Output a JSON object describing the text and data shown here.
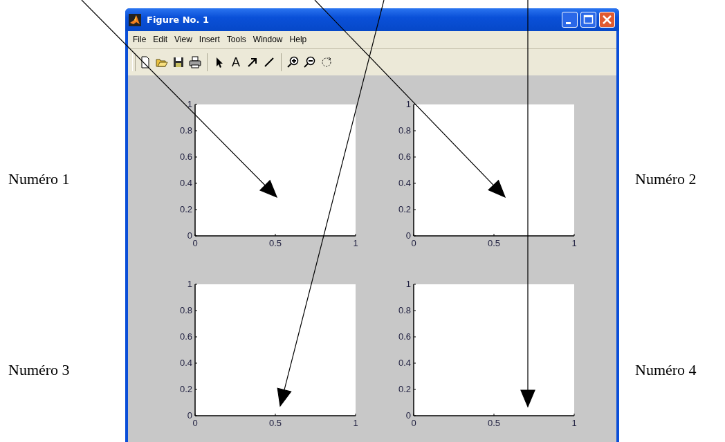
{
  "labels": [
    "Numéro 1",
    "Numéro 2",
    "Numéro 3",
    "Numéro 4"
  ],
  "window": {
    "title": "Figure No. 1"
  },
  "menu": [
    "File",
    "Edit",
    "View",
    "Insert",
    "Tools",
    "Window",
    "Help"
  ],
  "toolbar": [
    {
      "kind": "new"
    },
    {
      "kind": "open"
    },
    {
      "kind": "save"
    },
    {
      "kind": "print"
    },
    {
      "kind": "separator"
    },
    {
      "kind": "select"
    },
    {
      "kind": "text",
      "label": "A"
    },
    {
      "kind": "arrow"
    },
    {
      "kind": "line"
    },
    {
      "kind": "separator"
    },
    {
      "kind": "zoom-in"
    },
    {
      "kind": "zoom-out"
    },
    {
      "kind": "rotate"
    }
  ],
  "subplots": [
    {
      "chart_data": {
        "type": "line",
        "xlim": [
          0,
          1
        ],
        "ylim": [
          0,
          1
        ],
        "xticks": [
          0,
          0.5,
          1
        ],
        "yticks": [
          0,
          0.2,
          0.4,
          0.6,
          0.8,
          1
        ]
      }
    },
    {
      "chart_data": {
        "type": "line",
        "xlim": [
          0,
          1
        ],
        "ylim": [
          0,
          1
        ],
        "xticks": [
          0,
          0.5,
          1
        ],
        "yticks": [
          0,
          0.2,
          0.4,
          0.6,
          0.8,
          1
        ]
      }
    },
    {
      "chart_data": {
        "type": "line",
        "xlim": [
          0,
          1
        ],
        "ylim": [
          0,
          1
        ],
        "xticks": [
          0,
          0.5,
          1
        ],
        "yticks": [
          0,
          0.2,
          0.4,
          0.6,
          0.8,
          1
        ]
      }
    },
    {
      "chart_data": {
        "type": "line",
        "xlim": [
          0,
          1
        ],
        "ylim": [
          0,
          1
        ],
        "xticks": [
          0,
          0.5,
          1
        ],
        "yticks": [
          0,
          0.2,
          0.4,
          0.6,
          0.8,
          1
        ]
      }
    }
  ]
}
